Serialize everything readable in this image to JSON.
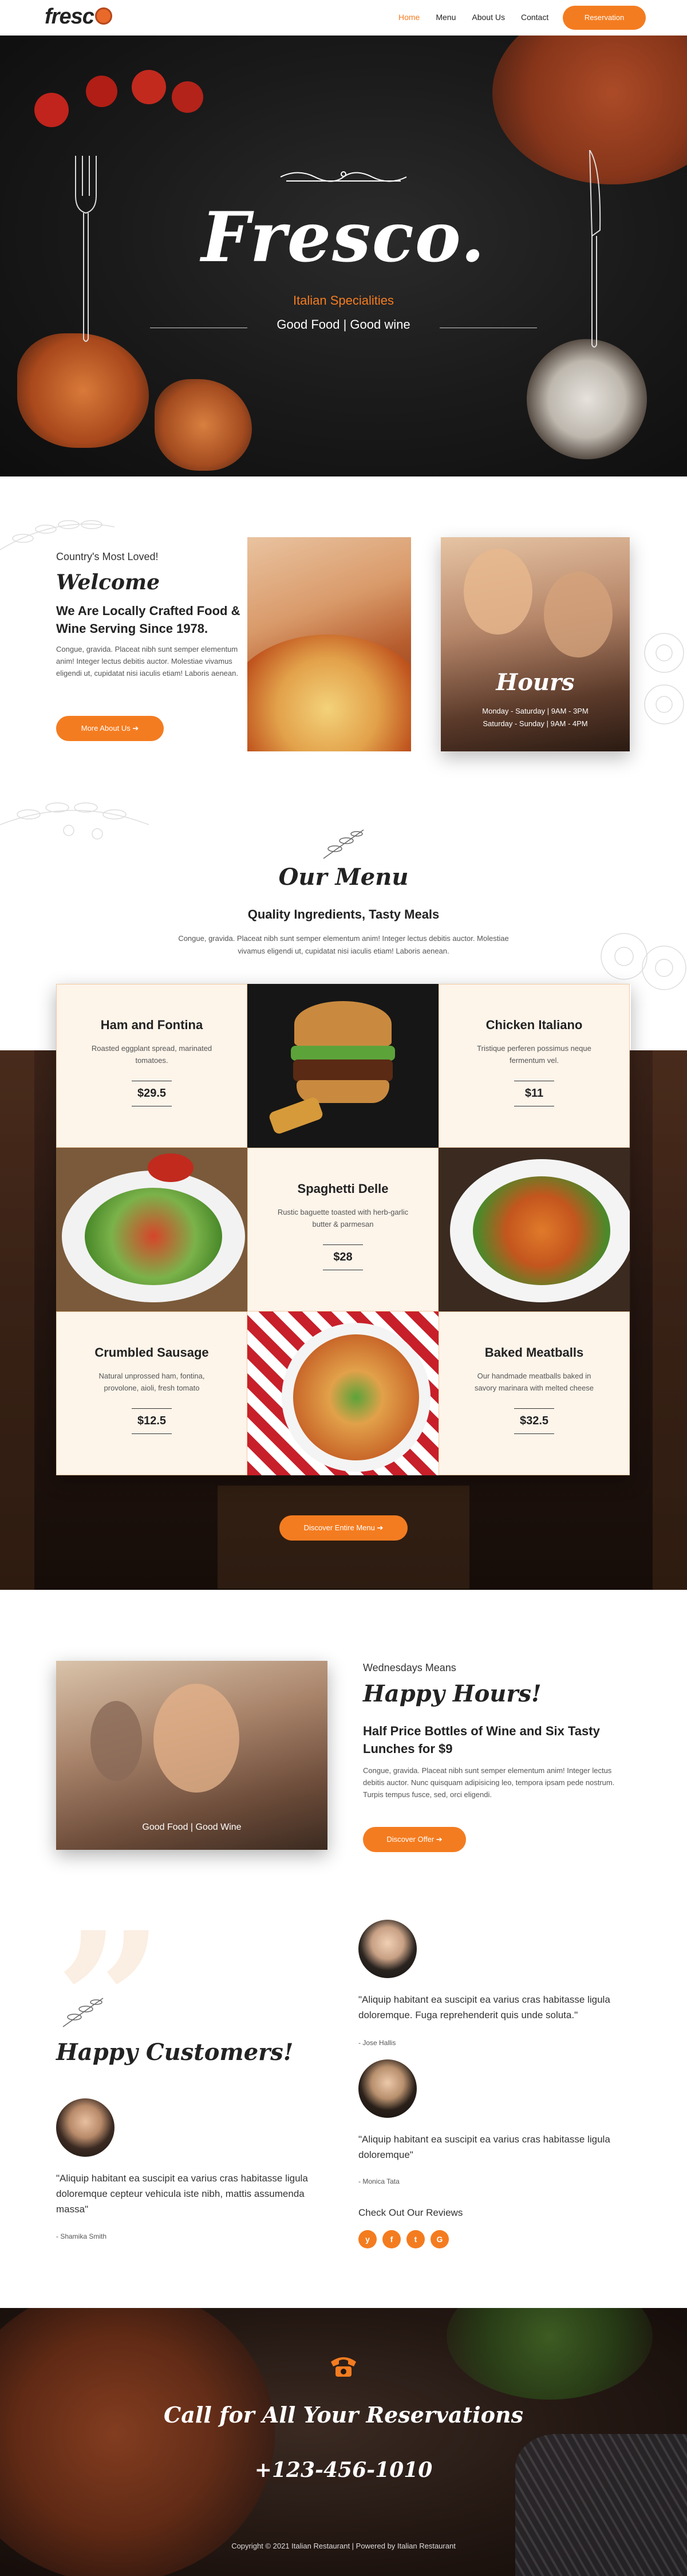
{
  "header": {
    "logo": "fresc",
    "nav": [
      "Home",
      "Menu",
      "About Us",
      "Contact"
    ],
    "reservation_label": "Reservation"
  },
  "hero": {
    "title": "Fresco.",
    "subtitle": "Italian Specialities",
    "tagline": "Good Food | Good wine"
  },
  "welcome": {
    "kicker": "Country's Most Loved!",
    "title": "Welcome",
    "heading": "We Are Locally Crafted Food & Wine Serving Since 1978.",
    "body": "Congue, gravida. Placeat nibh sunt semper elementum anim! Integer lectus debitis auctor. Molestiae vivamus eligendi ut, cupidatat nisi iaculis etiam! Laboris aenean.",
    "button": "More About Us",
    "hours_title": "Hours",
    "hours": [
      "Monday - Saturday | 9AM - 3PM",
      "Saturday - Sunday | 9AM - 4PM"
    ]
  },
  "menu": {
    "title": "Our Menu",
    "subtitle": "Quality Ingredients, Tasty Meals",
    "body": "Congue, gravida. Placeat nibh sunt semper elementum anim! Integer lectus debitis auctor. Molestiae vivamus eligendi ut, cupidatat nisi iaculis etiam! Laboris aenean.",
    "items": [
      {
        "name": "Ham and Fontina",
        "desc": "Roasted eggplant spread, marinated tomatoes.",
        "price": "$29.5"
      },
      {
        "name": "Chicken Italiano",
        "desc": "Tristique perferen possimus neque fermentum vel.",
        "price": "$11"
      },
      {
        "name": "Spaghetti Delle",
        "desc": "Rustic baguette toasted with herb-garlic butter & parmesan",
        "price": "$28"
      },
      {
        "name": "Crumbled Sausage",
        "desc": "Natural unprossed ham, fontina, provolone, aioli, fresh tomato",
        "price": "$12.5"
      },
      {
        "name": "Baked Meatballs",
        "desc": "Our handmade meatballs baked in savory marinara with melted cheese",
        "price": "$32.5"
      }
    ],
    "button": "Discover Entire Menu"
  },
  "happy_hours": {
    "caption": "Good Food | Good Wine",
    "kicker": "Wednesdays Means",
    "title": "Happy Hours!",
    "heading": "Half Price Bottles of Wine and Six Tasty Lunches for $9",
    "body": "Congue, gravida. Placeat nibh sunt semper elementum anim! Integer lectus debitis auctor. Nunc quisquam adipisicing leo, tempora ipsam pede nostrum. Turpis tempus fusce, sed, orci eligendi.",
    "button": "Discover Offer"
  },
  "testimonials": {
    "title": "Happy Customers!",
    "reviews": [
      {
        "quote": "\"Aliquip habitant ea suscipit ea varius cras habitasse ligula doloremque cepteur vehicula iste nibh, mattis assumenda massa\"",
        "author": "- Shamika Smith"
      },
      {
        "quote": "\"Aliquip habitant ea suscipit ea varius cras habitasse ligula doloremque. Fuga reprehenderit quis unde soluta.\"",
        "author": "- Jose Hallis"
      },
      {
        "quote": "\"Aliquip habitant ea suscipit ea varius cras habitasse ligula doloremque\"",
        "author": "- Monica Tata"
      }
    ],
    "reviews_label": "Check Out Our Reviews",
    "socials": [
      "yelp-icon",
      "facebook-icon",
      "twitter-icon",
      "google-icon"
    ]
  },
  "footer": {
    "title": "Call for All Your Reservations",
    "phone": "+123-456-1010",
    "copyright": "Copyright © 2021 Italian Restaurant | Powered by Italian Restaurant"
  },
  "colors": {
    "accent": "#f47c20",
    "dark": "#1a1a1a",
    "cream": "#fdf4ea"
  }
}
